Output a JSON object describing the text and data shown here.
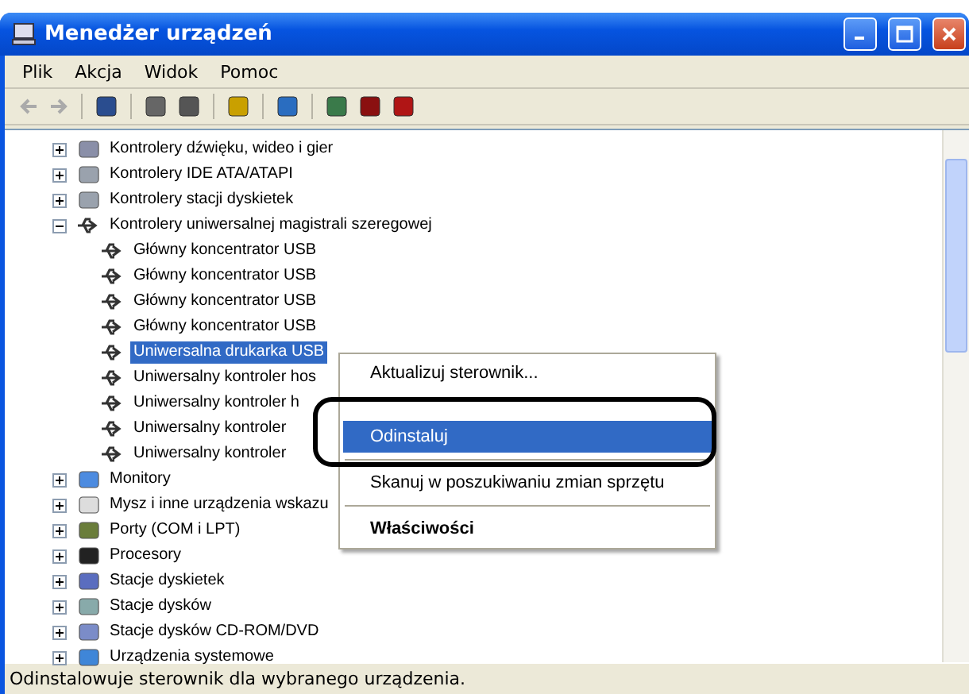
{
  "window": {
    "title": "Menedżer urządzeń"
  },
  "menu_bar": [
    "Plik",
    "Akcja",
    "Widok",
    "Pomoc"
  ],
  "tree": [
    {
      "label": "Kontrolery dźwięku, wideo i gier",
      "kind": "sound",
      "expanded": false,
      "selected": false
    },
    {
      "label": "Kontrolery IDE ATA/ATAPI",
      "kind": "drive",
      "expanded": false,
      "selected": false
    },
    {
      "label": "Kontrolery stacji dyskietek",
      "kind": "drive",
      "expanded": false,
      "selected": false
    },
    {
      "label": "Kontrolery uniwersalnej magistrali szeregowej",
      "kind": "usb",
      "expanded": true,
      "selected": false,
      "children": [
        {
          "label": "Główny koncentrator USB",
          "kind": "usb",
          "selected": false
        },
        {
          "label": "Główny koncentrator USB",
          "kind": "usb",
          "selected": false
        },
        {
          "label": "Główny koncentrator USB",
          "kind": "usb",
          "selected": false
        },
        {
          "label": "Główny koncentrator USB",
          "kind": "usb",
          "selected": false
        },
        {
          "label": "Uniwersalna drukarka USB",
          "kind": "usb",
          "selected": true
        },
        {
          "label": "Uniwersalny kontroler hos",
          "kind": "usb",
          "selected": false
        },
        {
          "label": "Uniwersalny kontroler h",
          "kind": "usb",
          "selected": false
        },
        {
          "label": "Uniwersalny kontroler",
          "kind": "usb",
          "selected": false
        },
        {
          "label": "Uniwersalny kontroler",
          "kind": "usb",
          "selected": false
        }
      ]
    },
    {
      "label": "Monitory",
      "kind": "monitor",
      "expanded": false,
      "selected": false
    },
    {
      "label": "Mysz i inne urządzenia wskazu",
      "kind": "mouse",
      "expanded": false,
      "selected": false
    },
    {
      "label": "Porty (COM i LPT)",
      "kind": "port",
      "expanded": false,
      "selected": false
    },
    {
      "label": "Procesory",
      "kind": "cpu",
      "expanded": false,
      "selected": false
    },
    {
      "label": "Stacje dyskietek",
      "kind": "floppy",
      "expanded": false,
      "selected": false
    },
    {
      "label": "Stacje dysków",
      "kind": "disk",
      "expanded": false,
      "selected": false
    },
    {
      "label": "Stacje dysków CD-ROM/DVD",
      "kind": "cdrom",
      "expanded": false,
      "selected": false
    },
    {
      "label": "Urządzenia systemowe",
      "kind": "system",
      "expanded": false,
      "selected": false
    }
  ],
  "context_menu": [
    {
      "kind": "item",
      "label": "Aktualizuj sterownik...",
      "selected": false
    },
    {
      "kind": "obscured"
    },
    {
      "kind": "item",
      "label": "Odinstaluj",
      "selected": true
    },
    {
      "kind": "separator"
    },
    {
      "kind": "item",
      "label": "Skanuj w poszukiwaniu zmian sprzętu",
      "selected": false
    },
    {
      "kind": "separator"
    },
    {
      "kind": "default",
      "label": "Właściwości",
      "selected": false
    }
  ],
  "status_bar": "Odinstalowuje sterownik dla wybranego urządzenia."
}
